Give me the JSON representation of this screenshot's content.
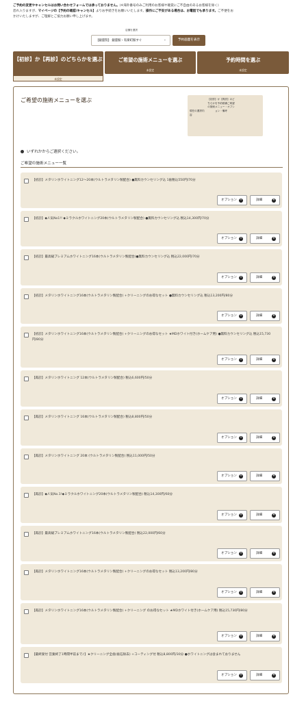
{
  "notice": {
    "line1_bold": "ご予約の変更やキャンセルはお問い合わせフォームでは承っておりません。",
    "line1_rest": "(※海外番号のみご利用のお客様や聴覚にご不自由のあるお客様を除く)",
    "line2_pre": "恐れ入りますが、",
    "line2_bold1": "マイページの【予約の確認/キャンセル】",
    "line2_mid": "よりお手続きをお願いいたします。",
    "line2_bold2": "操作にご不安がある場合は、お電話でも承ります。",
    "line2_post": "ご不便をお",
    "line3": "かけいたしますが、ご理解とご協力お願い申し上げます。"
  },
  "store": {
    "label": "店舗を選択",
    "selected": "【銀座院】 銀座駅・有楽町駅すぐ",
    "reserve_button": "予約画面を表示"
  },
  "steps": [
    {
      "label": "【初診】か【再診】のどちらかを選ぶ",
      "status": "未設定"
    },
    {
      "label": "ご希望の施術メニューを選ぶ",
      "status": "未設定"
    },
    {
      "label": "予約時間を選ぶ",
      "status": "未設定"
    }
  ],
  "panel": {
    "title": "ご希望の施術メニューを選ぶ",
    "current_label": "現在の選択内容",
    "current_value": "【初診】か【再診】のどちらかを予約候補ご希望の施術メニュー・オプション・備考",
    "instruction": "いずれかからご選択ください。",
    "list_title": "ご希望の施術メニュー一覧"
  },
  "buttons": {
    "option": "オプション",
    "detail": "詳細"
  },
  "menus": [
    {
      "name": "【初診】メタリンホワイトニング12〜20本(ウルトラメタリン製配合) ●無料カウンセリング込 1歯税込550円/70分"
    },
    {
      "name": "【初診】◆人気No1!! ◆ミラクルホワイトニング20本(ウルトラメタリン製配合) ●無料カウンセリング込 税込14,300円/70分"
    },
    {
      "name": "【初診】最高級プレミアムホワイトニング16本(ウルトラメタリン製配合)●無料カウンセリング込 税込22,000円/70分"
    },
    {
      "name": "【初診】メタリンホワイトニング16本(ウルトラメタリン製配合) +クリーニングのお得なセット ●無料カウンセリング込 税込13,200円/80分"
    },
    {
      "name": "【初診】メタリンホワイトニング16本(ウルトラメタリン製配合) +クリーニングのお得なセット ★MDホワイト付き(ホームケア用) ●無料カウンセリング込 税込15,730円/80分"
    },
    {
      "name": "【再診】メタリンホワイトニング 12本(ウルトラメタリン製配合) 税込6,600円/50分"
    },
    {
      "name": "【再診】メタリンホワイトニング 16本(ウルトラメタリン製配合) 税込8,800円/50分"
    },
    {
      "name": "【再診】メタリンホワイトニング 20本 (ウルトラメタリン製配合) 税込11,000円/50分"
    },
    {
      "name": "【再診】◆人気No.1!◆ミラクルホワイトニング20本(ウルトラメタリン製配合) 税込14,300円/60分"
    },
    {
      "name": "【再診】最高級プレミアムホワイトニング16本(ウルトラメタリン製配合) 税込22,000円/60分"
    },
    {
      "name": "【再診】メタリンホワイトニング16本(ウルトラメタリン製配合) +クリーニングのお得なセット 税込13,200円/80分"
    },
    {
      "name": "【再診】メタリンホワイトニング16本(ウルトラメタリン製配合) +クリーニング のお得なセット ★MDホワイト付き(ホームケア用) 税込15,730円/80分"
    },
    {
      "name": "【最終受付 営業終了1時間半前まで♪】★クリーニング全歯(歯石除去) +コーティング付 税込8,800円/30分 ●ホワイトニングは含まれておりません"
    }
  ]
}
